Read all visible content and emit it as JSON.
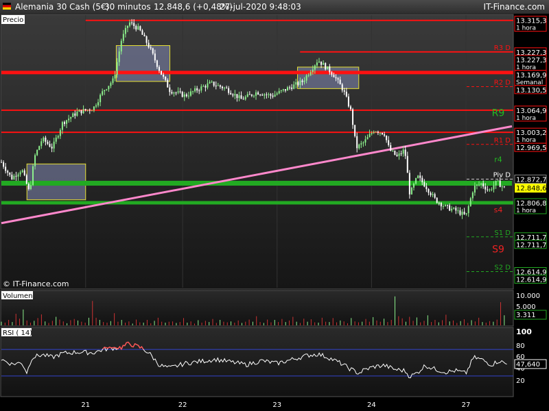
{
  "header": {
    "instrument": "Alemania 30 Cash (5€)",
    "timeframe": "30 minutos",
    "quote": "12.848,6 (+0,48%)",
    "datetime": "27-jul-2020 9:48:03",
    "brand": "IT-Finance.com"
  },
  "watermark": "© IT-Finance.com",
  "colors": {
    "resistance": "#ff1111",
    "support": "#22aa22",
    "trendline": "#ff88cc",
    "candle_up": "#8cf08c",
    "candle_down": "#ffffff",
    "price_tag": "#ffff00",
    "rsi_line": "#ffffff",
    "volume_bar": "#cc3333"
  },
  "chart_data": [
    {
      "type": "candlestick",
      "panel_label": "Precio",
      "x_ticks": [
        "21",
        "22",
        "23",
        "24",
        "27"
      ],
      "ylim": [
        12570,
        13330
      ],
      "last_price": "12.848,6",
      "horizontal_lines": [
        {
          "price": 13315.3,
          "value_label": "13.315,3",
          "sub_label": "1 hora",
          "color": "#ff1111",
          "style": "solid",
          "x_start": 0.165
        },
        {
          "price": 13227.3,
          "value_label": "13.227,3",
          "level_label": "R3 D",
          "color": "#ff1111",
          "style": "dashed"
        },
        {
          "price": 13227.3,
          "value_label": "13.227,3",
          "sub_label": "1 hora",
          "color": "#ff1111",
          "style": "solid",
          "x_start": 0.585
        },
        {
          "price": 13169.9,
          "value_label": "13.169,9",
          "sub_label": "Semanal",
          "color": "#ff1111",
          "style": "solid",
          "x_start": 0,
          "thick": true
        },
        {
          "price": 13130.5,
          "value_label": "13.130,5",
          "level_label": "R2 D",
          "color": "#ff1111",
          "style": "dashed"
        },
        {
          "price": 13064.9,
          "value_label": "13.064,9",
          "sub_label": "1 hora",
          "color": "#ff1111",
          "style": "solid",
          "x_start": 0
        },
        {
          "price": 13003.2,
          "value_label": "13.003,2",
          "sub_label": "1 hora",
          "color": "#ff1111",
          "style": "solid",
          "x_start": 0
        },
        {
          "price": 12969.5,
          "value_label": "12.969,5",
          "level_label": "R1 D",
          "color": "#ff1111",
          "style": "dashed"
        },
        {
          "price": 12872.7,
          "value_label": "12.872,7",
          "level_label": "Piv D",
          "color": "#cccccc",
          "style": "dashed"
        },
        {
          "price": 12806.8,
          "value_label": "12.806,8",
          "sub_label": "1 hora",
          "color": "#22aa22",
          "style": "solid",
          "x_start": 0,
          "thick": true
        },
        {
          "price": 12711.7,
          "value_label": "12.711,7",
          "level_label": "S1 D",
          "color": "#22aa22",
          "style": "dashed"
        },
        {
          "price": 12711.7,
          "value_label": "12.711,7",
          "color": "#22aa22",
          "style": "none"
        },
        {
          "price": 12614.9,
          "value_label": "12.614,9",
          "level_label": "S2 D",
          "color": "#22aa22",
          "style": "dashed"
        },
        {
          "price": 12614.9,
          "value_label": "12.614,9",
          "color": "#22aa22",
          "style": "none"
        }
      ],
      "support_band_top": 12868,
      "annotations": [
        {
          "text": "R9",
          "price": 13048,
          "color": "#22bb22"
        },
        {
          "text": "r4",
          "price": 12920,
          "color": "#22bb22"
        },
        {
          "text": "s4",
          "price": 12780,
          "color": "#ee2222"
        },
        {
          "text": "S9",
          "price": 12668,
          "color": "#ee2222"
        }
      ],
      "trendline": {
        "from": [
          0.0,
          12750
        ],
        "to": [
          1.0,
          13020
        ]
      },
      "zones": [
        {
          "from": 0.225,
          "to": 0.33,
          "low": 13145,
          "high": 13245
        },
        {
          "from": 0.58,
          "to": 0.7,
          "low": 13125,
          "high": 13185
        },
        {
          "from": 0.05,
          "to": 0.165,
          "low": 12815,
          "high": 12915
        }
      ],
      "path": [
        [
          0.0,
          12920
        ],
        [
          0.02,
          12875
        ],
        [
          0.04,
          12900
        ],
        [
          0.055,
          12835
        ],
        [
          0.065,
          12935
        ],
        [
          0.08,
          12985
        ],
        [
          0.1,
          12960
        ],
        [
          0.12,
          13030
        ],
        [
          0.15,
          13060
        ],
        [
          0.18,
          13070
        ],
        [
          0.2,
          13120
        ],
        [
          0.22,
          13150
        ],
        [
          0.235,
          13260
        ],
        [
          0.25,
          13310
        ],
        [
          0.27,
          13290
        ],
        [
          0.29,
          13240
        ],
        [
          0.31,
          13175
        ],
        [
          0.33,
          13120
        ],
        [
          0.36,
          13105
        ],
        [
          0.38,
          13120
        ],
        [
          0.41,
          13140
        ],
        [
          0.44,
          13125
        ],
        [
          0.47,
          13095
        ],
        [
          0.5,
          13115
        ],
        [
          0.53,
          13105
        ],
        [
          0.56,
          13125
        ],
        [
          0.59,
          13145
        ],
        [
          0.62,
          13205
        ],
        [
          0.65,
          13165
        ],
        [
          0.67,
          13120
        ],
        [
          0.685,
          13060
        ],
        [
          0.695,
          12960
        ],
        [
          0.71,
          12975
        ],
        [
          0.73,
          13010
        ],
        [
          0.75,
          13000
        ],
        [
          0.76,
          12955
        ],
        [
          0.775,
          12935
        ],
        [
          0.79,
          12955
        ],
        [
          0.8,
          12830
        ],
        [
          0.815,
          12880
        ],
        [
          0.83,
          12855
        ],
        [
          0.85,
          12815
        ],
        [
          0.87,
          12795
        ],
        [
          0.89,
          12785
        ],
        [
          0.91,
          12770
        ],
        [
          0.925,
          12850
        ],
        [
          0.94,
          12860
        ],
        [
          0.955,
          12840
        ],
        [
          0.97,
          12865
        ],
        [
          0.985,
          12848
        ]
      ]
    },
    {
      "type": "bar",
      "panel_label": "Volumen",
      "y_ticks": [
        "10.000",
        "5.000"
      ],
      "last_value": "3.311",
      "ylim": [
        0,
        11000
      ],
      "values": [
        1200,
        900,
        1800,
        1100,
        3800,
        2200,
        5200,
        1600,
        900,
        1500,
        2400,
        3600,
        1300,
        800,
        1500,
        2800,
        1900,
        1300,
        700,
        1700,
        2100,
        1600,
        1200,
        900,
        2500,
        8000,
        2500,
        1800,
        1100,
        900,
        1400,
        4000,
        1200,
        1800,
        900,
        1300,
        600,
        1900,
        1000,
        900,
        1800,
        700,
        1500,
        2500,
        1200,
        900,
        1200,
        1300,
        800,
        1100,
        2400,
        900,
        1300,
        600,
        1700,
        900,
        1500,
        1100,
        2100,
        800,
        1800,
        1200,
        1000,
        1300,
        900,
        1600,
        800,
        1200,
        1900,
        1200,
        3000,
        1100,
        800,
        1900,
        1000,
        1800,
        1100,
        2100,
        1100,
        1600,
        2800,
        1200,
        800,
        2200,
        1200,
        2000,
        1000,
        900,
        2500,
        1200,
        1100,
        2400,
        1000,
        1600,
        1300,
        700,
        2400,
        1300,
        1000,
        1200,
        2100,
        1200,
        2700,
        1600,
        1200,
        2200,
        1100,
        1800,
        9500,
        3000,
        2300,
        1200,
        2800,
        1500,
        2600,
        1000,
        1500,
        3300,
        1100,
        1800,
        1000,
        1700,
        3500,
        1300,
        1600,
        800,
        1400,
        2000,
        800,
        1700,
        1300,
        2500,
        1100,
        900,
        1400,
        1200,
        1900,
        7600,
        3311
      ]
    },
    {
      "type": "line",
      "panel_label": "RSI ( 14)",
      "y_ticks": [
        "100",
        "80",
        "60",
        "40",
        "20"
      ],
      "last_value": "47,640",
      "ylim": [
        0,
        100
      ],
      "overbought": 70,
      "oversold": 30,
      "x": [
        0.0,
        0.02,
        0.04,
        0.05,
        0.06,
        0.08,
        0.1,
        0.12,
        0.15,
        0.18,
        0.2,
        0.22,
        0.235,
        0.25,
        0.26,
        0.275,
        0.29,
        0.31,
        0.33,
        0.36,
        0.39,
        0.42,
        0.45,
        0.48,
        0.51,
        0.54,
        0.57,
        0.6,
        0.62,
        0.64,
        0.665,
        0.68,
        0.7,
        0.71,
        0.73,
        0.75,
        0.77,
        0.79,
        0.8,
        0.815,
        0.83,
        0.85,
        0.87,
        0.89,
        0.91,
        0.925,
        0.94,
        0.96,
        0.975,
        0.99
      ],
      "values": [
        55,
        48,
        50,
        35,
        58,
        62,
        58,
        64,
        66,
        65,
        70,
        72,
        73,
        79,
        76,
        72,
        64,
        46,
        42,
        49,
        52,
        55,
        51,
        47,
        53,
        49,
        55,
        61,
        63,
        58,
        49,
        42,
        34,
        39,
        44,
        46,
        40,
        38,
        29,
        35,
        46,
        40,
        36,
        38,
        34,
        58,
        55,
        47,
        53,
        47.64
      ]
    }
  ]
}
